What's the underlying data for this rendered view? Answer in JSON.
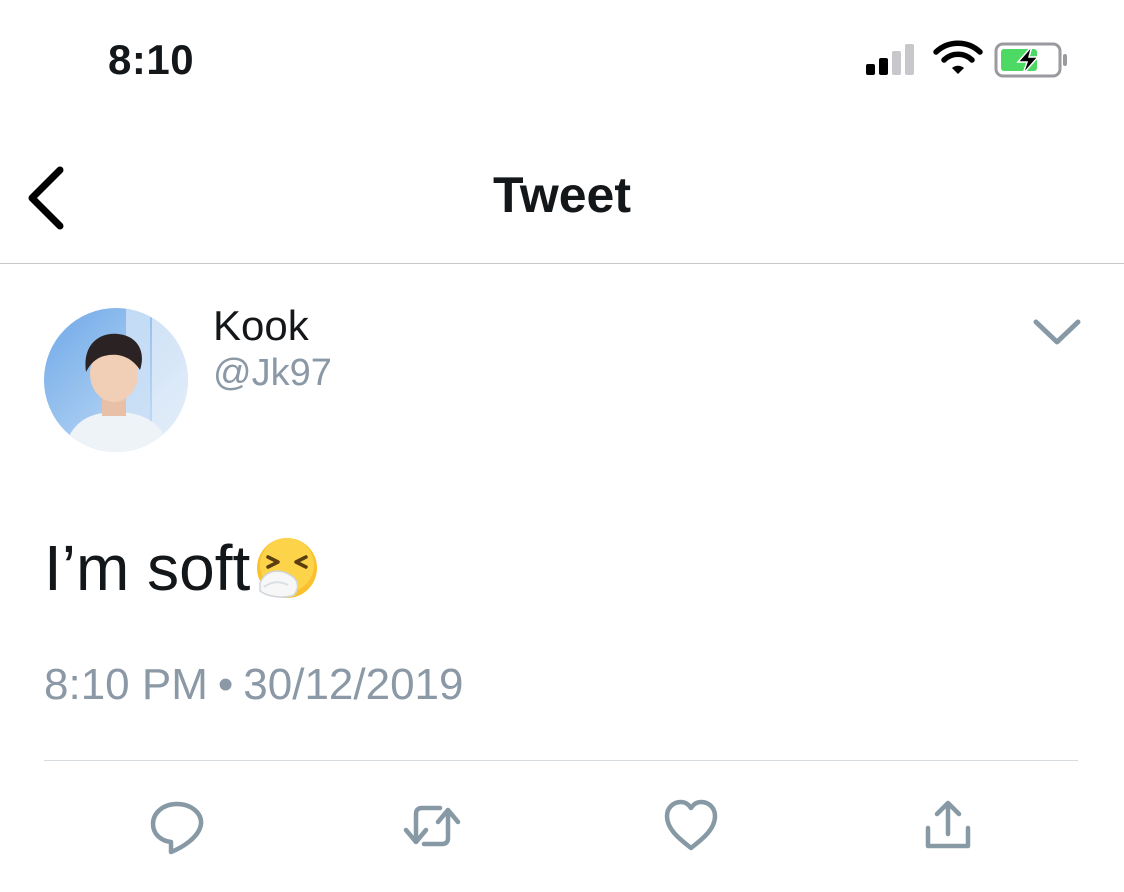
{
  "status_bar": {
    "time": "8:10",
    "battery_color": "#4cd964"
  },
  "nav": {
    "title": "Tweet",
    "back_icon": "chevron-left-icon"
  },
  "tweet": {
    "author": {
      "name": "Kook",
      "handle": "@Jk97"
    },
    "text": "I’m soft",
    "emoji": "sneezing-face",
    "time": "8:10 PM",
    "separator": "•",
    "date": "30/12/2019"
  },
  "actions": [
    {
      "icon": "reply-icon"
    },
    {
      "icon": "retweet-icon"
    },
    {
      "icon": "like-icon"
    },
    {
      "icon": "share-icon"
    }
  ],
  "colors": {
    "secondary_text": "#8b98a5",
    "action_icon": "#8899a6",
    "divider": "#c9c9cc"
  }
}
